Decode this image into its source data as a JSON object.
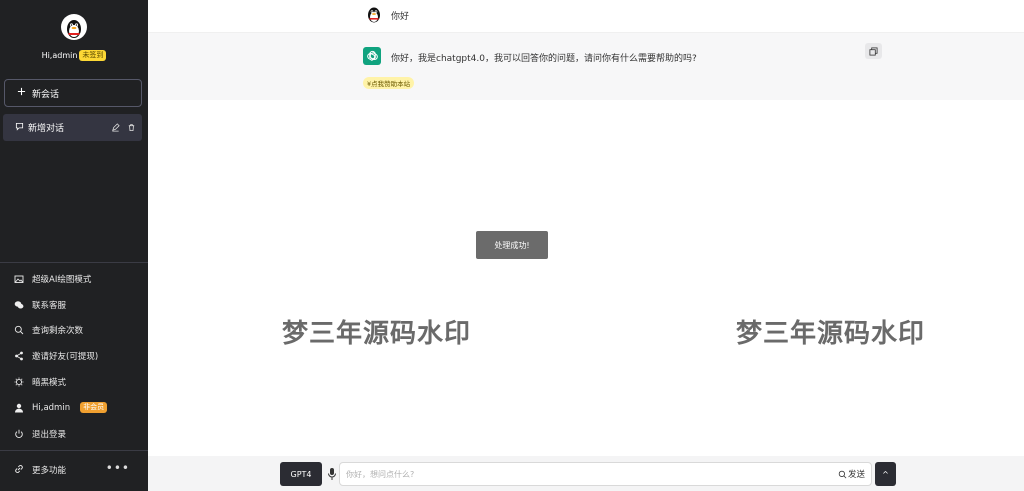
{
  "sidebar": {
    "user_greeting": "Hi,admin",
    "sign_badge": "未签到",
    "new_chat_label": "新会话",
    "conversation": {
      "title": "新增对话"
    },
    "menu": [
      {
        "label": "超级AI绘图模式",
        "icon": "image-icon"
      },
      {
        "label": "联系客服",
        "icon": "wechat-icon"
      },
      {
        "label": "查询剩余次数",
        "icon": "search-icon"
      },
      {
        "label": "邀请好友(可提现)",
        "icon": "share-icon"
      },
      {
        "label": "暗黑模式",
        "icon": "theme-icon"
      },
      {
        "label": "Hi,admin",
        "icon": "user-icon",
        "badge": "非会员"
      },
      {
        "label": "退出登录",
        "icon": "power-icon"
      }
    ],
    "more_label": "更多功能",
    "more_dots": "•••"
  },
  "chat": {
    "user_message": "你好",
    "bot_message": "你好，我是chatgpt4.0，我可以回答你的问题，请问你有什么需要帮助的吗?",
    "donate_label": "¥点我赞助本站"
  },
  "toast": "处理成功!",
  "watermark": "梦三年源码水印",
  "composer": {
    "model_label": "GPT4",
    "placeholder": "你好，想问点什么?",
    "send_label": "发送",
    "scroll_symbol": "^"
  },
  "colors": {
    "sidebar_bg": "#202123",
    "accent_gpt": "#10a37f",
    "badge_yellow": "#fdd835",
    "badge_orange": "#f0a030"
  }
}
